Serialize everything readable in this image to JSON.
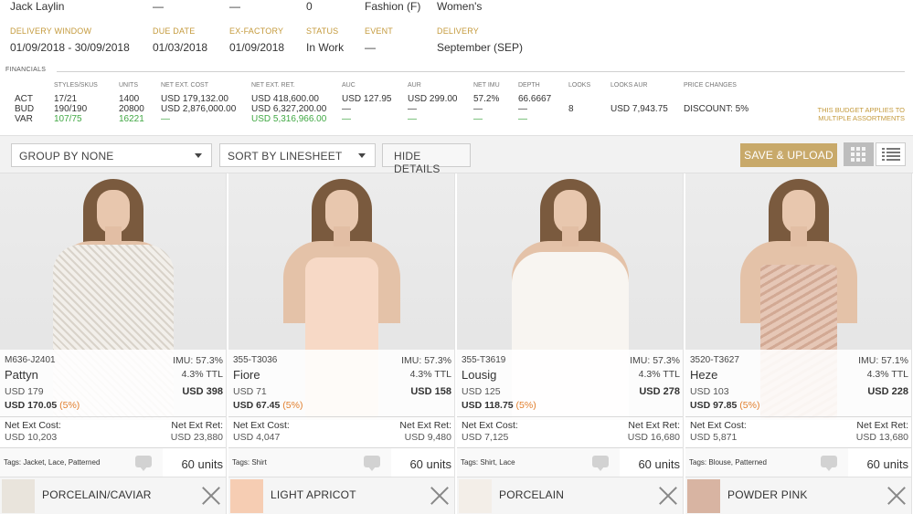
{
  "header": {
    "row1": [
      "Jack Laylin",
      "—",
      "—",
      "0",
      "Fashion (F)",
      "Women's"
    ],
    "labels": {
      "delivery_window": "DELIVERY WINDOW",
      "due_date": "DUE DATE",
      "ex_factory": "EX-FACTORY",
      "status": "STATUS",
      "event": "EVENT",
      "delivery": "DELIVERY"
    },
    "values": {
      "delivery_window": "01/09/2018 - 30/09/2018",
      "due_date": "01/03/2018",
      "ex_factory": "01/09/2018",
      "status": "In Work",
      "event": "—",
      "delivery": "September (SEP)"
    }
  },
  "financials": {
    "label": "FINANCIALS",
    "headers": [
      "STYLES/SKUS",
      "UNITS",
      "NET EXT. COST",
      "NET EXT. RET.",
      "AUC",
      "AUR",
      "NET IMU",
      "DEPTH",
      "LOOKS",
      "LOOKS AUR",
      "PRICE CHANGES"
    ],
    "rows": {
      "act": {
        "label": "ACT",
        "styles": "17/21",
        "units": "1400",
        "cost": "USD 179,132.00",
        "ret": "USD 418,600.00",
        "auc": "USD 127.95",
        "aur": "USD 299.00",
        "imu": "57.2%",
        "depth": "66.6667"
      },
      "bud": {
        "label": "BUD",
        "styles": "190/190",
        "units": "20800",
        "cost": "USD 2,876,000.00",
        "ret": "USD 6,327,200.00",
        "auc": "—",
        "aur": "—",
        "imu": "—",
        "depth": "—"
      },
      "var": {
        "label": "VAR",
        "styles": "107/75",
        "units": "16221",
        "cost": "—",
        "ret": "USD 5,316,966.00",
        "auc": "—",
        "aur": "—",
        "imu": "—",
        "depth": "—"
      }
    },
    "looks": "8",
    "looks_aur": "USD 7,943.75",
    "price_changes": "DISCOUNT: 5%",
    "budget_note": "THIS BUDGET APPLIES TO MULTIPLE ASSORTMENTS"
  },
  "toolbar": {
    "group_by": "GROUP BY NONE",
    "sort_by": "SORT BY LINESHEET",
    "hide_details": "HIDE DETAILS",
    "save_upload": "SAVE & UPLOAD"
  },
  "colors": {
    "gold": "#c49a3c",
    "save_button": "#c8a96a",
    "green": "#41a844",
    "discount_orange": "#e2802f"
  },
  "cards": [
    {
      "sku": "M636-J2401",
      "imu": "IMU: 57.3%",
      "name": "Pattyn",
      "ttl": "4.3% TTL",
      "price": "USD 179",
      "retail": "USD 398",
      "sale": "USD 170.05",
      "sale_pct": "(5%)",
      "net_cost_label": "Net Ext Cost:",
      "net_cost": "USD 10,203",
      "net_ret_label": "Net Ext Ret:",
      "net_ret": "USD 23,880",
      "tags": "Tags: Jacket, Lace, Patterned",
      "units": "60 units",
      "color_name": "PORCELAIN/CAVIAR",
      "swatch": "#e9e4dc"
    },
    {
      "sku": "355-T3036",
      "imu": "IMU: 57.3%",
      "name": "Fiore",
      "ttl": "4.3% TTL",
      "price": "USD 71",
      "retail": "USD 158",
      "sale": "USD 67.45",
      "sale_pct": "(5%)",
      "net_cost_label": "Net Ext Cost:",
      "net_cost": "USD 4,047",
      "net_ret_label": "Net Ext Ret:",
      "net_ret": "USD 9,480",
      "tags": "Tags: Shirt",
      "units": "60 units",
      "color_name": "LIGHT APRICOT",
      "swatch": "#f6cdb3"
    },
    {
      "sku": "355-T3619",
      "imu": "IMU: 57.3%",
      "name": "Lousig",
      "ttl": "4.3% TTL",
      "price": "USD 125",
      "retail": "USD 278",
      "sale": "USD 118.75",
      "sale_pct": "(5%)",
      "net_cost_label": "Net Ext Cost:",
      "net_cost": "USD 7,125",
      "net_ret_label": "Net Ext Ret:",
      "net_ret": "USD 16,680",
      "tags": "Tags: Shirt, Lace",
      "units": "60 units",
      "color_name": "PORCELAIN",
      "swatch": "#f3eee8"
    },
    {
      "sku": "3520-T3627",
      "imu": "IMU: 57.1%",
      "name": "Heze",
      "ttl": "4.3% TTL",
      "price": "USD 103",
      "retail": "USD 228",
      "sale": "USD 97.85",
      "sale_pct": "(5%)",
      "net_cost_label": "Net Ext Cost:",
      "net_cost": "USD 5,871",
      "net_ret_label": "Net Ext Ret:",
      "net_ret": "USD 13,680",
      "tags": "Tags: Blouse, Patterned",
      "units": "60 units",
      "color_name": "POWDER PINK",
      "swatch": "#d8b4a2"
    }
  ]
}
